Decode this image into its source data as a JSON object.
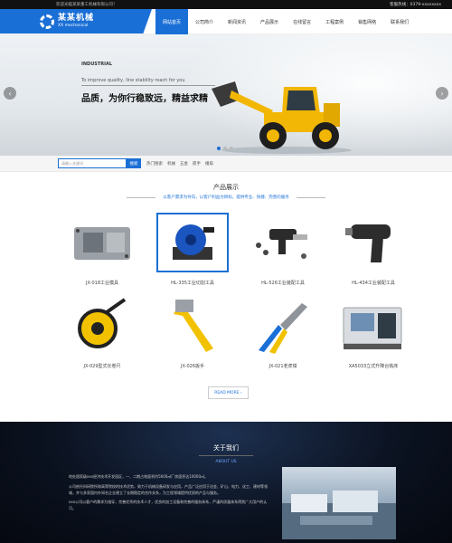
{
  "topbar": {
    "welcome": "欢迎光临某某重工机械有限公司！",
    "hotline_label": "客服热线：",
    "hotline": "0379-xxxxxxxx"
  },
  "logo": {
    "cn": "某某机械",
    "en": "XX mechanical"
  },
  "nav": [
    "网站首页",
    "公司简介",
    "新闻资讯",
    "产品展示",
    "在线留言",
    "工程案例",
    "销售网络",
    "联系我们"
  ],
  "banner": {
    "industrial_title": "INDUSTRIAL",
    "industrial_sub": "...",
    "tagline_en": "To improve quality, line stability reach for you",
    "tagline_cn": "品质，为你行稳致远，精益求精",
    "active_slide": 1,
    "slide_count": 3
  },
  "search": {
    "placeholder": "请输入关键词",
    "button": "搜索",
    "hot_label": "热门搜索",
    "hot_terms": [
      "机械",
      "五金",
      "扳手",
      "播扇"
    ]
  },
  "products": {
    "title": "产品展示",
    "subtitle": "以客户需求为导向，以客户利益为目标，提供专业、快捷、完善的服务",
    "items": [
      {
        "name": "JX-018工业模具"
      },
      {
        "name": "HL-335工业切割工具"
      },
      {
        "name": "HL-526工业装配工具"
      },
      {
        "name": "HL-434工业装配工具"
      },
      {
        "name": "JX-029型式长卷尺"
      },
      {
        "name": "JX-026扳手"
      },
      {
        "name": "JX-021老虎钳"
      },
      {
        "name": "XA5033立式升降台铣床"
      }
    ],
    "more": "READ MORE ›"
  },
  "about": {
    "title": "关于我们",
    "subtitle": "ABOUT US",
    "paragraphs": [
      "地处国家级xxx经济技术开发园区，一、二期占地面积约5600㎡厂房面积达10000㎡。",
      "公司依托科研院所和高等院校的技术优势，致力于机械设备研发与应用，产品广泛应用于冶金、矿山、电力、化工、建材等领域，并与多家国内外知名企业建立了长期稳定的合作关系，为工程领域提供优质的产品与服务。",
      "xxx公司以客户的需求为指导，完善优秀的技术人才，优良的加工设备和完善的服务体系，严谨的质量体系得到广大用户的认可。"
    ]
  },
  "colors": {
    "accent": "#1a6fd6",
    "loader_yellow": "#f2b705",
    "dark_bg": "#0b1220"
  }
}
